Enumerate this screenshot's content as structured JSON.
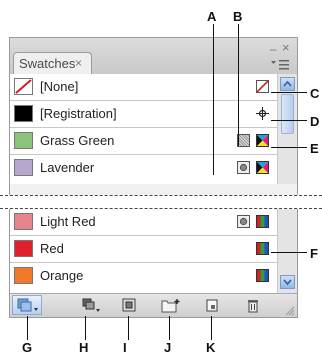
{
  "panel": {
    "tab_label": "Swatches",
    "tab_close_glyph": "×",
    "window_minimize_glyph": "–",
    "window_close_glyph": "×"
  },
  "swatches_top": [
    {
      "label": "[None]",
      "color": "#ffffff",
      "type": "none"
    },
    {
      "label": "[Registration]",
      "color": "#000000",
      "type": "registration"
    },
    {
      "label": "Grass Green",
      "color": "#8cc27a",
      "type": "process"
    },
    {
      "label": "Lavender",
      "color": "#b7a7cc",
      "type": "process"
    }
  ],
  "swatches_bottom": [
    {
      "label": "Light Red",
      "color": "#e8858a",
      "type": "process"
    },
    {
      "label": "Red",
      "color": "#e0202b",
      "type": "process"
    },
    {
      "label": "Orange",
      "color": "#f07a2a",
      "type": "process"
    }
  ],
  "callouts": {
    "A": "A",
    "B": "B",
    "C": "C",
    "D": "D",
    "E": "E",
    "F": "F",
    "G": "G",
    "H": "H",
    "I": "I",
    "J": "J",
    "K": "K"
  },
  "colors": {
    "panel_bg": "#f0f0f0",
    "selection": "#ffffff",
    "accent_blue": "#5b8fd8"
  },
  "icons": [
    "none-icon",
    "registration-icon",
    "global-swatch-icon",
    "spot-color-icon",
    "cmyk-icon",
    "rgb-icon",
    "lab-icon"
  ]
}
